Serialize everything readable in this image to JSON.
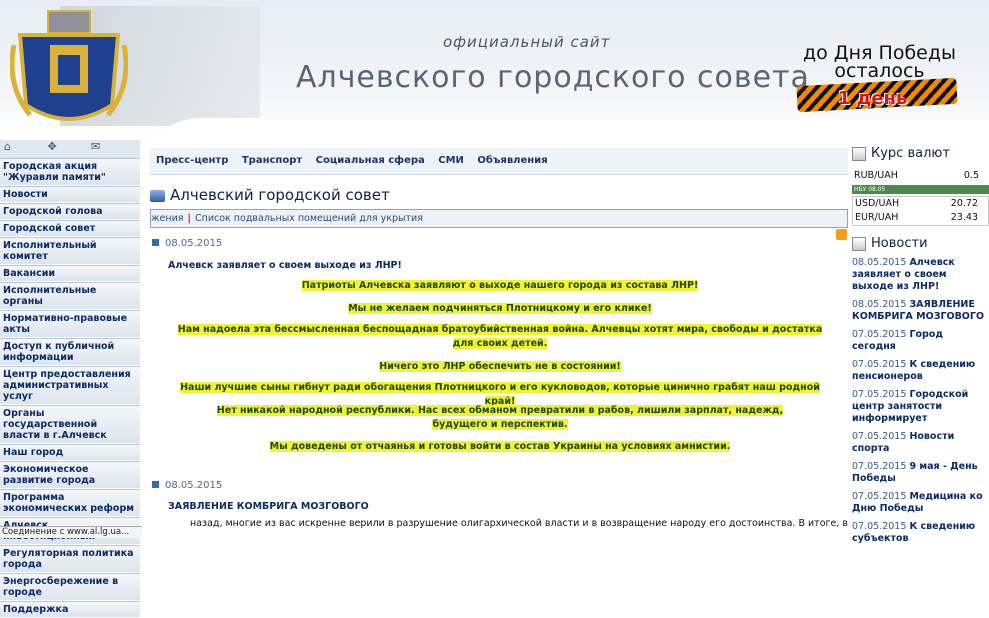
{
  "header": {
    "official_site": "официальный сайт",
    "council_name": "Алчевского городского совета",
    "victory_line1": "до Дня Победы",
    "victory_line2": "осталось",
    "days_left": "1 день"
  },
  "sidebar": {
    "icons": [
      "home-icon",
      "sitemap-icon",
      "mail-icon"
    ],
    "items": [
      {
        "label": "Городская акция \"Журавли памяти\""
      },
      {
        "label": "Новости"
      },
      {
        "label": "Городской голова"
      },
      {
        "label": "Городской совет"
      },
      {
        "label": "Исполнительный комитет"
      },
      {
        "label": "Вакансии"
      },
      {
        "label": "Исполнительные органы"
      },
      {
        "label": "Нормативно-правовые акты"
      },
      {
        "label": "Доступ к публичной информации"
      },
      {
        "label": "Центр предоставления административных услуг"
      },
      {
        "label": "Органы государственной власти в г.Алчевск"
      },
      {
        "label": "Наш город"
      },
      {
        "label": "Экономическое развитие города"
      },
      {
        "label": "Программа экономических реформ"
      },
      {
        "label": "Алчевск инвестиционный"
      },
      {
        "label": "Регуляторная политика города"
      },
      {
        "label": "Энергосбережение в городе"
      },
      {
        "label": "Поддержка"
      }
    ]
  },
  "tabs": [
    {
      "label": "Пресс-центр"
    },
    {
      "label": "Транспорт"
    },
    {
      "label": "Социальная сфера"
    },
    {
      "label": "СМИ"
    },
    {
      "label": "Объявления"
    }
  ],
  "main": {
    "page_title": "Алчевский городской совет",
    "crumb_left": "жения",
    "crumb_right": "Список подвальных помещений для укрытия",
    "article1": {
      "date": "08.05.2015",
      "title": "Алчевск заявляет о своем выходе из ЛНР!",
      "lines": [
        "Патриоты Алчевска заявляют о выходе нашего города из состава ЛНР!",
        "Мы не желаем подчиняться Плотницкому и его клике!",
        "Нам надоела эта бессмысленная беспощадная братоубийственная война. Алчевцы хотят мира, свободы и достатка для своих детей.",
        "Ничего это ЛНР обеспечить не в состоянии!",
        "Наши лучшие сыны гибнут ради обогащения Плотницкого и его кукловодов, которые цинично грабят наш родной край!",
        "Нет никакой народной республики. Нас всех обманом превратили в рабов, лишили зарплат, надежд, будущего и перспектив.",
        "Мы доведены от отчаянья и готовы войти в состав Украины на условиях амнистии."
      ]
    },
    "article2": {
      "date": "08.05.2015",
      "title": "ЗАЯВЛЕНИЕ КОМБРИГА МОЗГОВОГО",
      "text": "назад, многие из вас искренне верили в разрушение олигархической власти и в возвращение народу его достоинства. В итоге, в"
    }
  },
  "right": {
    "rates_title": "Курс валют",
    "rub_label": "RUB/UAH",
    "rub_value": "0.5",
    "nbu_label": "НБУ 08.05",
    "usd_label": "USD/UAH",
    "usd_value": "20.72",
    "eur_label": "EUR/UAH",
    "eur_value": "23.43",
    "news_title": "Новости",
    "news": [
      {
        "date": "08.05.2015",
        "title": "Алчевск заявляет о своем выходе из ЛНР!"
      },
      {
        "date": "08.05.2015",
        "title": "ЗАЯВЛЕНИЕ КОМБРИГА МОЗГОВОГО"
      },
      {
        "date": "07.05.2015",
        "title": "Город сегодня"
      },
      {
        "date": "07.05.2015",
        "title": "К сведению пенсионеров"
      },
      {
        "date": "07.05.2015",
        "title": "Городской центр занятости информирует"
      },
      {
        "date": "07.05.2015",
        "title": "Новости спорта"
      },
      {
        "date": "07.05.2015",
        "title": "9 мая - День Победы"
      },
      {
        "date": "07.05.2015",
        "title": "Медицина ко Дню Победы"
      },
      {
        "date": "07.05.2015",
        "title": "К сведению субъектов"
      }
    ]
  },
  "status": {
    "text": "Соединение с www.al.lg.ua..."
  }
}
